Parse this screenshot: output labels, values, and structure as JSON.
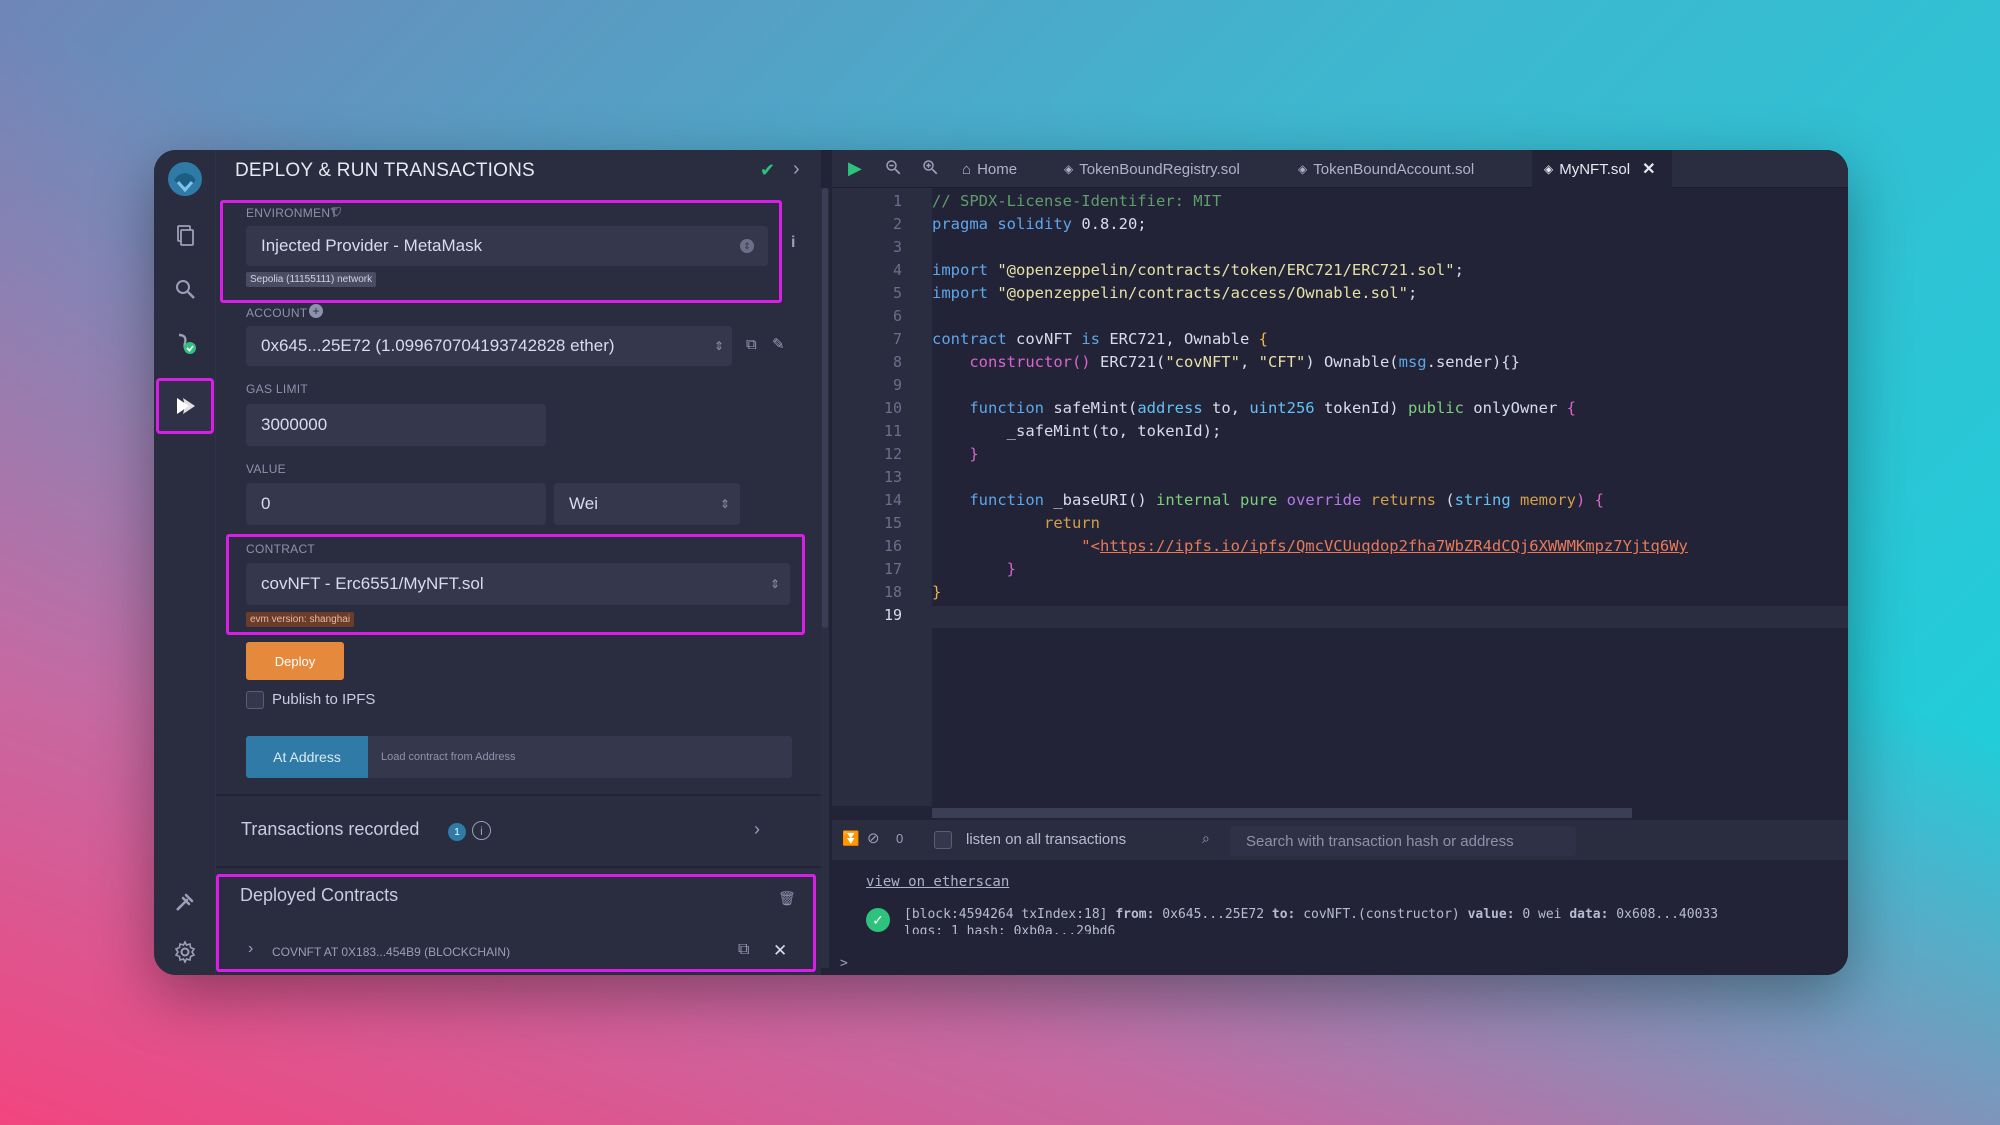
{
  "panel": {
    "title": "DEPLOY & RUN TRANSACTIONS",
    "environment_label": "ENVIRONMENT",
    "environment_value": "Injected Provider - MetaMask",
    "network_badge": "Sepolia (11155111) network",
    "account_label": "ACCOUNT",
    "account_value": "0x645...25E72 (1.099670704193742828 ether)",
    "gas_limit_label": "GAS LIMIT",
    "gas_limit_value": "3000000",
    "value_label": "VALUE",
    "value_amount": "0",
    "value_unit": "Wei",
    "contract_label": "CONTRACT",
    "contract_value": "covNFT - Erc6551/MyNFT.sol",
    "evm_badge": "evm version: shanghai",
    "deploy_label": "Deploy",
    "publish_label": "Publish to IPFS",
    "at_address_label": "At Address",
    "load_contract_placeholder": "Load contract from Address",
    "transactions_recorded_label": "Transactions recorded",
    "transactions_count": "1",
    "deployed_contracts_label": "Deployed Contracts",
    "deployed_item": "COVNFT AT 0X183...454B9 (BLOCKCHAIN)"
  },
  "tabs": [
    {
      "label": "Home"
    },
    {
      "label": "TokenBoundRegistry.sol"
    },
    {
      "label": "TokenBoundAccount.sol"
    },
    {
      "label": "MyNFT.sol"
    }
  ],
  "editor": {
    "line_numbers": [
      "1",
      "2",
      "3",
      "4",
      "5",
      "6",
      "7",
      "8",
      "9",
      "10",
      "11",
      "12",
      "13",
      "14",
      "15",
      "16",
      "17",
      "18",
      "19"
    ],
    "lines": {
      "l1": "// SPDX-License-Identifier: MIT",
      "l2a": "pragma solidity ",
      "l2b": "0.8.20;",
      "l4a": "import ",
      "l4b": "\"@openzeppelin/contracts/token/ERC721/ERC721.sol\"",
      "l4c": ";",
      "l5a": "import ",
      "l5b": "\"@openzeppelin/contracts/access/Ownable.sol\"",
      "l5c": ";",
      "l7a": "contract ",
      "l7b": "covNFT ",
      "l7c": "is ",
      "l7d": "ERC721, Ownable ",
      "l7e": "{",
      "l8a": "    constructor() ",
      "l8b": "ERC721(",
      "l8c": "\"covNFT\"",
      "l8d": ", ",
      "l8e": "\"CFT\"",
      "l8f": ") Ownable(",
      "l8g": "msg",
      "l8h": ".sender){}",
      "l10a": "    function ",
      "l10b": "safeMint(",
      "l10c": "address ",
      "l10d": "to, ",
      "l10e": "uint256 ",
      "l10f": "tokenId) ",
      "l10g": "public ",
      "l10h": "onlyOwner ",
      "l10i": "{",
      "l11": "        _safeMint(to, tokenId);",
      "l12": "    }",
      "l14a": "    function ",
      "l14b": "_baseURI() ",
      "l14c": "internal ",
      "l14d": "pure ",
      "l14e": "override ",
      "l14f": "returns ",
      "l14g": "(",
      "l14h": "string ",
      "l14i": "memory",
      "l14j": ") {",
      "l15": "            return",
      "l16a": "                \"<",
      "l16b": "https://ipfs.io/ipfs/QmcVCUuqdop2fha7WbZR4dCQj6XWWMKmpz7Yjtq6Wy",
      "l17": "        }",
      "l18": "}"
    }
  },
  "terminal": {
    "count": "0",
    "listen_label": "listen on all transactions",
    "search_placeholder": "Search with transaction hash or address",
    "etherscan_link": "view on etherscan",
    "log_line1_a": "[block:4594264 txIndex:18] ",
    "log_line1_b": "from: ",
    "log_line1_c": "0x645...25E72 ",
    "log_line1_d": "to: ",
    "log_line1_e": "covNFT.(constructor) ",
    "log_line1_f": "value: ",
    "log_line1_g": "0 wei ",
    "log_line1_h": "data: ",
    "log_line1_i": "0x608...40033",
    "log_line2": "logs: 1 hash: 0xb0a...29bd6",
    "prompt": ">"
  },
  "colors": {
    "highlight": "#d91ee8",
    "deploy": "#e58a3c",
    "at_address": "#2f7aa6",
    "success": "#2ec27e"
  }
}
